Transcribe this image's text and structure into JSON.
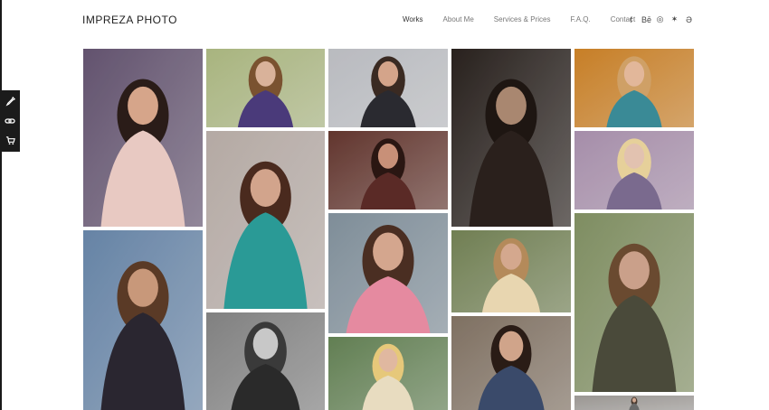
{
  "site": {
    "logo": "IMPREZA PHOTO"
  },
  "nav": {
    "items": [
      {
        "label": "Works",
        "active": true
      },
      {
        "label": "About Me",
        "active": false
      },
      {
        "label": "Services & Prices",
        "active": false
      },
      {
        "label": "F.A.Q.",
        "active": false
      },
      {
        "label": "Contact",
        "active": false
      }
    ]
  },
  "social": [
    {
      "icon": "facebook-icon",
      "glyph": "f"
    },
    {
      "icon": "behance-icon",
      "glyph": "Bē"
    },
    {
      "icon": "instagram-icon",
      "glyph": "◎"
    },
    {
      "icon": "lastfm-icon",
      "glyph": "✶"
    },
    {
      "icon": "vk-icon",
      "glyph": "Ə"
    }
  ],
  "toolbar": [
    {
      "icon": "eyedropper-icon"
    },
    {
      "icon": "link-icon"
    },
    {
      "icon": "cart-icon"
    }
  ],
  "colors": {
    "nav_text": "#777777",
    "nav_active": "#333333",
    "toolbar_bg": "#1b1b1b"
  },
  "gallery": {
    "photos": [
      {
        "name": "photo-woman-dark-hair-smiling",
        "bg": "#6b5a78",
        "skin": "#d6a58a",
        "hair": "#2a1c18",
        "cloth": "#e8c9c2"
      },
      {
        "name": "photo-woman-in-park",
        "bg": "#b7c48a",
        "skin": "#d9b29a",
        "hair": "#7a5230",
        "cloth": "#4a3a7a"
      },
      {
        "name": "photo-woman-blue-wall",
        "bg": "#c9cbd0",
        "skin": "#d4a48a",
        "hair": "#3a2a22",
        "cloth": "#2a2a30"
      },
      {
        "name": "photo-woman-portrait-dark",
        "bg": "#2c2420",
        "skin": "#a98770",
        "hair": "#1e1612",
        "cloth": "#2a201c"
      },
      {
        "name": "photo-blonde-with-lollipop-orange",
        "bg": "#d98a2a",
        "skin": "#e2b79a",
        "hair": "#cfa066",
        "cloth": "#3a8a96"
      },
      {
        "name": "photo-woman-city-pose",
        "bg": "#6f8fb4",
        "skin": "#c8987a",
        "hair": "#5a3a26",
        "cloth": "#2a2630"
      },
      {
        "name": "photo-woman-teal-jacket",
        "bg": "#c4b8b2",
        "skin": "#d2a48c",
        "hair": "#4a2a1e",
        "cloth": "#2a9a96"
      },
      {
        "name": "photo-woman-lollipop-closeup",
        "bg": "#6a3a32",
        "skin": "#c89078",
        "hair": "#2a1612",
        "cloth": "#5a2a26"
      },
      {
        "name": "photo-woman-graffiti-wall",
        "bg": "#8a9aa6",
        "skin": "#d4a68e",
        "hair": "#4a2e22",
        "cloth": "#e58aa0"
      },
      {
        "name": "photo-woman-bw-portrait",
        "bg": "#8c8c8c",
        "skin": "#c8c8c8",
        "hair": "#3a3a3a",
        "cloth": "#2a2a2a"
      },
      {
        "name": "photo-blonde-lollipop-purple",
        "bg": "#b49ab8",
        "skin": "#e2c2b0",
        "hair": "#e6d09a",
        "cloth": "#7a6a8e"
      },
      {
        "name": "photo-woman-bridge-walk",
        "bg": "#7a8a5a",
        "skin": "#d4a88e",
        "hair": "#b48a5a",
        "cloth": "#e8d6b0"
      },
      {
        "name": "photo-woman-on-tree",
        "bg": "#8a9a6a",
        "skin": "#caa08a",
        "hair": "#6a4a30",
        "cloth": "#4a4a3a"
      },
      {
        "name": "photo-blonde-in-meadow",
        "bg": "#6a8a5a",
        "skin": "#e0b8a0",
        "hair": "#e6c87a",
        "cloth": "#e8dcc0"
      },
      {
        "name": "photo-woman-with-bicycle",
        "bg": "#8a7a6a",
        "skin": "#d0a48a",
        "hair": "#2a1c16",
        "cloth": "#3a4a6a"
      },
      {
        "name": "photo-partial-bottom",
        "bg": "#a8a4a0",
        "skin": "#d0a890",
        "hair": "#4a3a30",
        "cloth": "#6a6a6a"
      }
    ]
  }
}
